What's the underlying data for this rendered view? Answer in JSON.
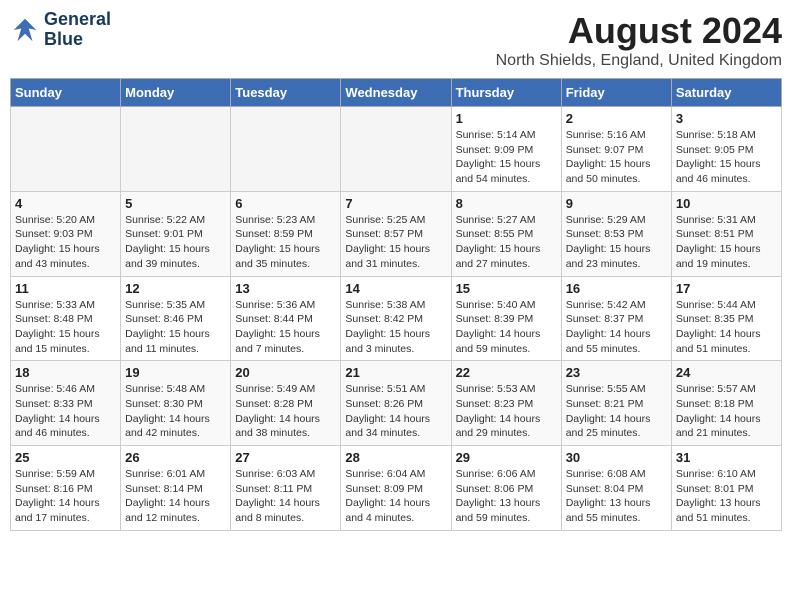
{
  "header": {
    "logo_line1": "General",
    "logo_line2": "Blue",
    "title": "August 2024",
    "subtitle": "North Shields, England, United Kingdom"
  },
  "days_of_week": [
    "Sunday",
    "Monday",
    "Tuesday",
    "Wednesday",
    "Thursday",
    "Friday",
    "Saturday"
  ],
  "weeks": [
    [
      {
        "day": "",
        "empty": true
      },
      {
        "day": "",
        "empty": true
      },
      {
        "day": "",
        "empty": true
      },
      {
        "day": "",
        "empty": true
      },
      {
        "day": "1",
        "info": "Sunrise: 5:14 AM\nSunset: 9:09 PM\nDaylight: 15 hours\nand 54 minutes."
      },
      {
        "day": "2",
        "info": "Sunrise: 5:16 AM\nSunset: 9:07 PM\nDaylight: 15 hours\nand 50 minutes."
      },
      {
        "day": "3",
        "info": "Sunrise: 5:18 AM\nSunset: 9:05 PM\nDaylight: 15 hours\nand 46 minutes."
      }
    ],
    [
      {
        "day": "4",
        "info": "Sunrise: 5:20 AM\nSunset: 9:03 PM\nDaylight: 15 hours\nand 43 minutes."
      },
      {
        "day": "5",
        "info": "Sunrise: 5:22 AM\nSunset: 9:01 PM\nDaylight: 15 hours\nand 39 minutes."
      },
      {
        "day": "6",
        "info": "Sunrise: 5:23 AM\nSunset: 8:59 PM\nDaylight: 15 hours\nand 35 minutes."
      },
      {
        "day": "7",
        "info": "Sunrise: 5:25 AM\nSunset: 8:57 PM\nDaylight: 15 hours\nand 31 minutes."
      },
      {
        "day": "8",
        "info": "Sunrise: 5:27 AM\nSunset: 8:55 PM\nDaylight: 15 hours\nand 27 minutes."
      },
      {
        "day": "9",
        "info": "Sunrise: 5:29 AM\nSunset: 8:53 PM\nDaylight: 15 hours\nand 23 minutes."
      },
      {
        "day": "10",
        "info": "Sunrise: 5:31 AM\nSunset: 8:51 PM\nDaylight: 15 hours\nand 19 minutes."
      }
    ],
    [
      {
        "day": "11",
        "info": "Sunrise: 5:33 AM\nSunset: 8:48 PM\nDaylight: 15 hours\nand 15 minutes."
      },
      {
        "day": "12",
        "info": "Sunrise: 5:35 AM\nSunset: 8:46 PM\nDaylight: 15 hours\nand 11 minutes."
      },
      {
        "day": "13",
        "info": "Sunrise: 5:36 AM\nSunset: 8:44 PM\nDaylight: 15 hours\nand 7 minutes."
      },
      {
        "day": "14",
        "info": "Sunrise: 5:38 AM\nSunset: 8:42 PM\nDaylight: 15 hours\nand 3 minutes."
      },
      {
        "day": "15",
        "info": "Sunrise: 5:40 AM\nSunset: 8:39 PM\nDaylight: 14 hours\nand 59 minutes."
      },
      {
        "day": "16",
        "info": "Sunrise: 5:42 AM\nSunset: 8:37 PM\nDaylight: 14 hours\nand 55 minutes."
      },
      {
        "day": "17",
        "info": "Sunrise: 5:44 AM\nSunset: 8:35 PM\nDaylight: 14 hours\nand 51 minutes."
      }
    ],
    [
      {
        "day": "18",
        "info": "Sunrise: 5:46 AM\nSunset: 8:33 PM\nDaylight: 14 hours\nand 46 minutes."
      },
      {
        "day": "19",
        "info": "Sunrise: 5:48 AM\nSunset: 8:30 PM\nDaylight: 14 hours\nand 42 minutes."
      },
      {
        "day": "20",
        "info": "Sunrise: 5:49 AM\nSunset: 8:28 PM\nDaylight: 14 hours\nand 38 minutes."
      },
      {
        "day": "21",
        "info": "Sunrise: 5:51 AM\nSunset: 8:26 PM\nDaylight: 14 hours\nand 34 minutes."
      },
      {
        "day": "22",
        "info": "Sunrise: 5:53 AM\nSunset: 8:23 PM\nDaylight: 14 hours\nand 29 minutes."
      },
      {
        "day": "23",
        "info": "Sunrise: 5:55 AM\nSunset: 8:21 PM\nDaylight: 14 hours\nand 25 minutes."
      },
      {
        "day": "24",
        "info": "Sunrise: 5:57 AM\nSunset: 8:18 PM\nDaylight: 14 hours\nand 21 minutes."
      }
    ],
    [
      {
        "day": "25",
        "info": "Sunrise: 5:59 AM\nSunset: 8:16 PM\nDaylight: 14 hours\nand 17 minutes."
      },
      {
        "day": "26",
        "info": "Sunrise: 6:01 AM\nSunset: 8:14 PM\nDaylight: 14 hours\nand 12 minutes."
      },
      {
        "day": "27",
        "info": "Sunrise: 6:03 AM\nSunset: 8:11 PM\nDaylight: 14 hours\nand 8 minutes."
      },
      {
        "day": "28",
        "info": "Sunrise: 6:04 AM\nSunset: 8:09 PM\nDaylight: 14 hours\nand 4 minutes."
      },
      {
        "day": "29",
        "info": "Sunrise: 6:06 AM\nSunset: 8:06 PM\nDaylight: 13 hours\nand 59 minutes."
      },
      {
        "day": "30",
        "info": "Sunrise: 6:08 AM\nSunset: 8:04 PM\nDaylight: 13 hours\nand 55 minutes."
      },
      {
        "day": "31",
        "info": "Sunrise: 6:10 AM\nSunset: 8:01 PM\nDaylight: 13 hours\nand 51 minutes."
      }
    ]
  ]
}
